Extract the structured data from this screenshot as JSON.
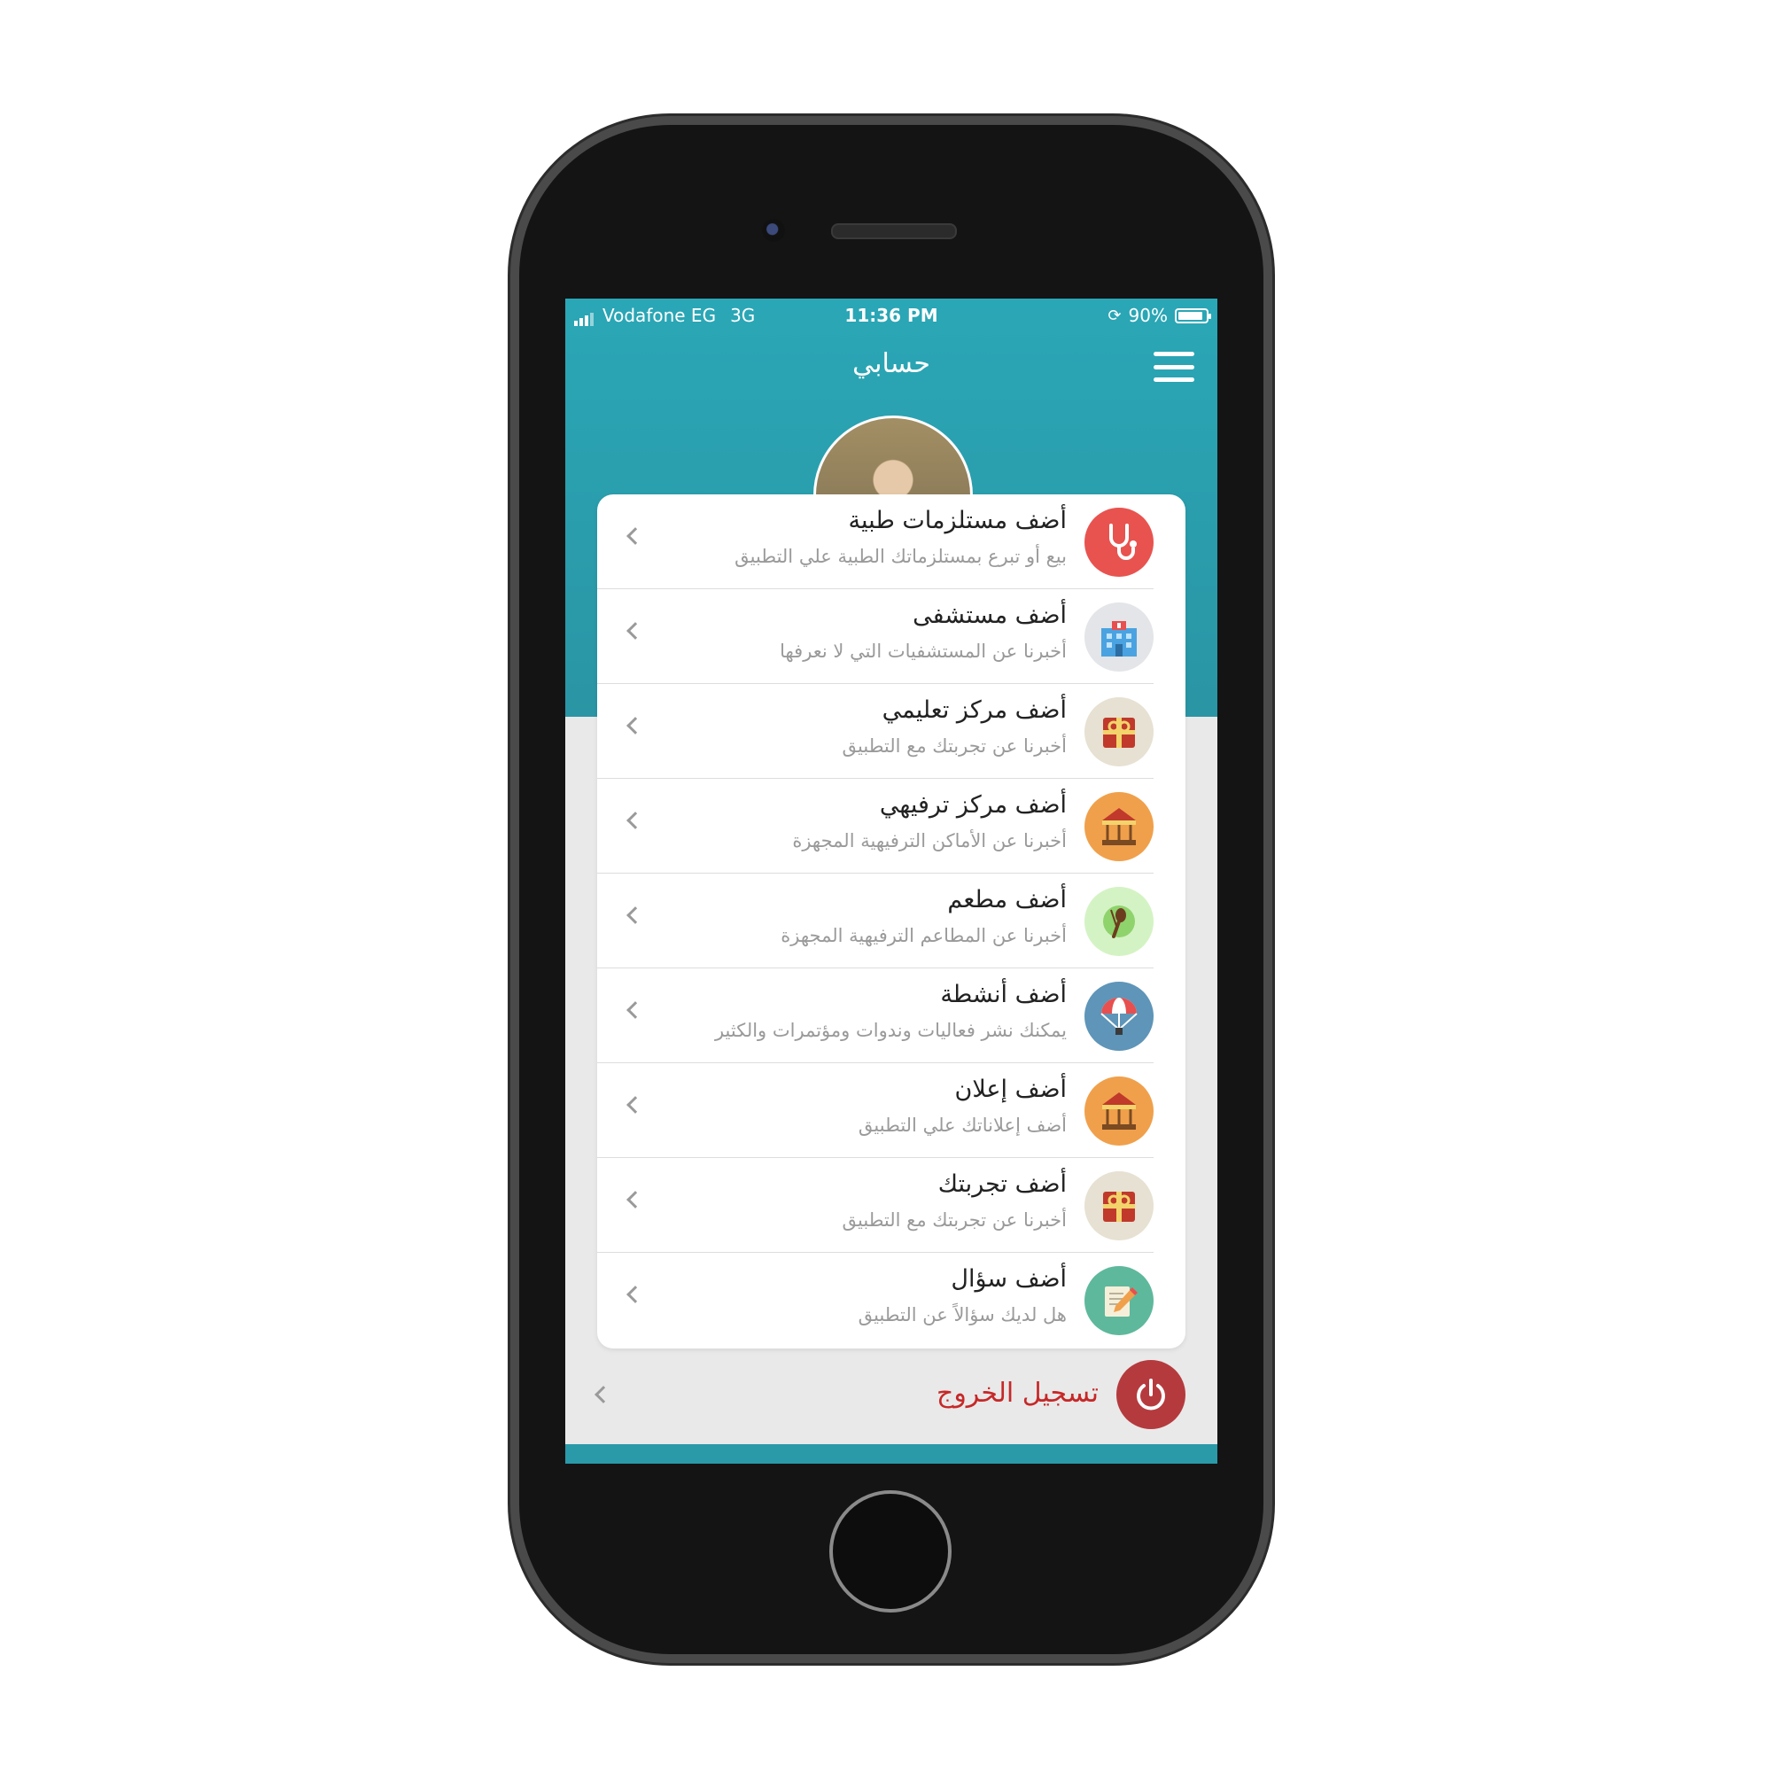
{
  "status_bar": {
    "carrier": "Vodafone EG",
    "network": "3G",
    "time": "11:36 PM",
    "battery": "90%",
    "battery_level": 0.9
  },
  "header": {
    "title": "حسابي",
    "menu_icon": "hamburger-menu-icon"
  },
  "menu": {
    "items": [
      {
        "title": "أضف مستلزمات طبية",
        "subtitle": "بيع أو تبرع بمستلزماتك الطبية علي التطبيق",
        "icon": "stethoscope-icon",
        "icon_bg": "#e8534f"
      },
      {
        "title": "أضف مستشفى",
        "subtitle": "أخبرنا عن المستشفيات التي لا نعرفها",
        "icon": "hospital-icon",
        "icon_bg": "#e3e5e8"
      },
      {
        "title": "أضف مركز تعليمي",
        "subtitle": "أخبرنا عن تجربتك مع التطبيق",
        "icon": "gift-icon",
        "icon_bg": "#e6e1d2"
      },
      {
        "title": "أضف مركز ترفيهي",
        "subtitle": "أخبرنا عن الأماكن الترفيهية المجهزة",
        "icon": "carousel-icon",
        "icon_bg": "#f0a04b"
      },
      {
        "title": "أضف مطعم",
        "subtitle": "أخبرنا عن المطاعم الترفيهية المجهزة",
        "icon": "spoon-fork-icon",
        "icon_bg": "#d4f3c4"
      },
      {
        "title": "أضف أنشطة",
        "subtitle": "يمكنك نشر فعاليات وندوات ومؤتمرات والكثير",
        "icon": "parachute-icon",
        "icon_bg": "#5e95b8"
      },
      {
        "title": "أضف إعلان",
        "subtitle": "أضف إعلاناتك علي التطبيق",
        "icon": "carousel-icon",
        "icon_bg": "#f0a04b"
      },
      {
        "title": "أضف تجربتك",
        "subtitle": "أخبرنا عن تجربتك مع التطبيق",
        "icon": "gift-icon",
        "icon_bg": "#e6e1d2"
      },
      {
        "title": "أضف سؤال",
        "subtitle": "هل لديك سؤالاً عن التطبيق",
        "icon": "pencil-note-icon",
        "icon_bg": "#5eb89c"
      }
    ]
  },
  "logout": {
    "label": "تسجيل الخروج",
    "icon": "power-icon",
    "color": "#c62828"
  },
  "colors": {
    "header_teal": "#2aa7b6",
    "background": "#e9e9e9"
  }
}
